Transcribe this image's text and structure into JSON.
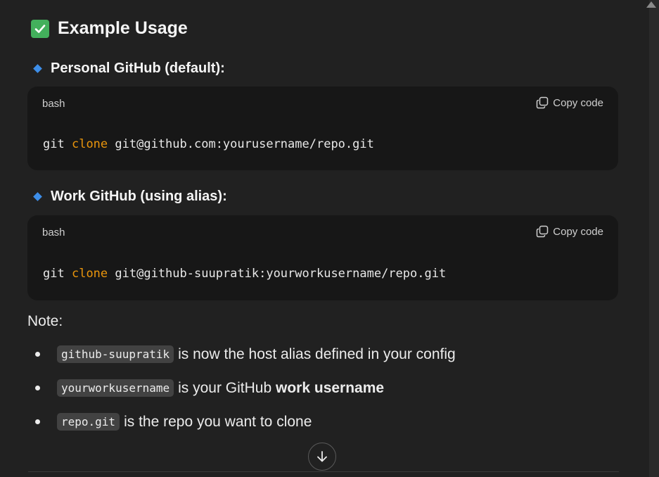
{
  "heading": {
    "title": "Example Usage",
    "icon": "check-box-icon",
    "icon_color": "#43b05c"
  },
  "sections": [
    {
      "title": "Personal GitHub (default):",
      "code": {
        "lang": "bash",
        "copy_label": "Copy code",
        "cmd": "git",
        "keyword": "clone",
        "arg": "git@github.com:yourusername/repo.git"
      }
    },
    {
      "title": "Work GitHub (using alias):",
      "code": {
        "lang": "bash",
        "copy_label": "Copy code",
        "cmd": "git",
        "keyword": "clone",
        "arg": "git@github-suupratik:yourworkusername/repo.git"
      }
    }
  ],
  "note": {
    "label": "Note:",
    "bullets": [
      {
        "code": "github-suupratik",
        "text": "is now the host alias defined in your config"
      },
      {
        "code": "yourworkusername",
        "text": "is your GitHub",
        "bold": "work username"
      },
      {
        "code": "repo.git",
        "text": "is the repo you want to clone"
      }
    ]
  },
  "colors": {
    "background": "#212121",
    "code_background": "#171717",
    "keyword": "#e9950c",
    "diamond": "#3d8ee8"
  }
}
